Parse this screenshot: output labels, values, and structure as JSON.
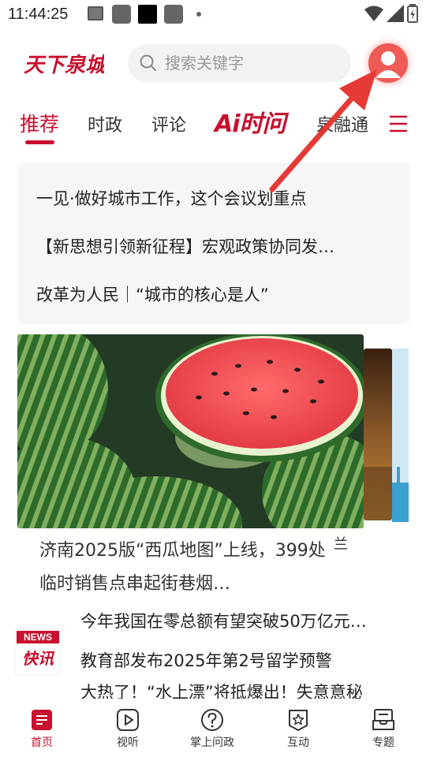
{
  "status_bar": {
    "time": "11:44:25"
  },
  "header": {
    "logo_text": "天下泉城",
    "search_placeholder": "搜索关键字"
  },
  "nav_tabs": [
    {
      "label": "推荐",
      "active": true
    },
    {
      "label": "时政"
    },
    {
      "label": "评论"
    },
    {
      "label": "Ai时问"
    },
    {
      "label": "泉融通"
    }
  ],
  "headlines": [
    "一见·做好城市工作，这个会议划重点",
    "【新思想引领新征程】宏观政策协同发…",
    "改革为人民｜“城市的核心是人”"
  ],
  "carousel": {
    "caption": "济南2025版“西瓜地图”上线，399处临时销售点串起街巷烟…",
    "peek_text": "兰"
  },
  "news_flash": {
    "badge_top": "NEWS",
    "badge_bottom": "快讯",
    "items": [
      "今年我国在零总额有望突破50万亿元…",
      "教育部发布2025年第2号留学预警",
      "大热了！“水上漂”将抵爆出！失意意秘"
    ]
  },
  "bottom_nav": [
    {
      "label": "首页",
      "icon": "home-news-icon",
      "active": true
    },
    {
      "label": "视听",
      "icon": "play-video-icon"
    },
    {
      "label": "掌上问政",
      "icon": "question-icon"
    },
    {
      "label": "互动",
      "icon": "star-badge-icon"
    },
    {
      "label": "专题",
      "icon": "inbox-tray-icon"
    }
  ],
  "colors": {
    "brand_red": "#c8102e",
    "avatar_red": "#ee5a55",
    "annotation_arrow": "#e53935"
  }
}
